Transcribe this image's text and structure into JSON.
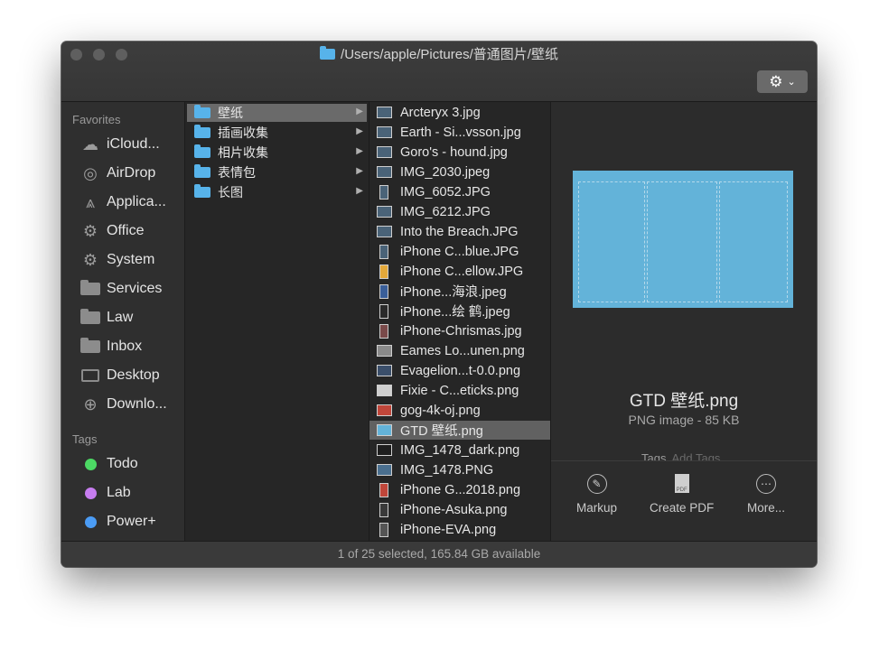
{
  "window": {
    "title": "/Users/apple/Pictures/普通图片/壁纸",
    "icons": {
      "title_folder": "folder-icon",
      "action_menu": "gear-icon"
    }
  },
  "sidebar": {
    "favorites_label": "Favorites",
    "favorites": [
      {
        "label": "iCloud...",
        "icon": "cloud-icon"
      },
      {
        "label": "AirDrop",
        "icon": "airdrop-icon"
      },
      {
        "label": "Applica...",
        "icon": "applications-icon"
      },
      {
        "label": "Office",
        "icon": "gear-icon"
      },
      {
        "label": "System",
        "icon": "gear-icon"
      },
      {
        "label": "Services",
        "icon": "folder-icon"
      },
      {
        "label": "Law",
        "icon": "folder-icon"
      },
      {
        "label": "Inbox",
        "icon": "folder-icon"
      },
      {
        "label": "Desktop",
        "icon": "desktop-icon"
      },
      {
        "label": "Downlo...",
        "icon": "download-icon"
      }
    ],
    "tags_label": "Tags",
    "tags": [
      {
        "label": "Todo",
        "color": "#4cd964"
      },
      {
        "label": "Lab",
        "color": "#c77df0"
      },
      {
        "label": "Power+",
        "color": "#4b9cf5"
      }
    ]
  },
  "column1": {
    "items": [
      {
        "label": "壁纸",
        "selected": true
      },
      {
        "label": "插画收集",
        "selected": false
      },
      {
        "label": "相片收集",
        "selected": false
      },
      {
        "label": "表情包",
        "selected": false
      },
      {
        "label": "长图",
        "selected": false
      }
    ]
  },
  "column2": {
    "items": [
      {
        "label": "Arcteryx 3.jpg"
      },
      {
        "label": "Earth - Si...vsson.jpg"
      },
      {
        "label": "Goro's - hound.jpg"
      },
      {
        "label": "IMG_2030.jpeg"
      },
      {
        "label": "IMG_6052.JPG"
      },
      {
        "label": "IMG_6212.JPG"
      },
      {
        "label": "Into the Breach.JPG"
      },
      {
        "label": "iPhone C...blue.JPG"
      },
      {
        "label": "iPhone C...ellow.JPG"
      },
      {
        "label": "iPhone...海浪.jpeg"
      },
      {
        "label": "iPhone...绘 鹤.jpeg"
      },
      {
        "label": "iPhone-Chrismas.jpg"
      },
      {
        "label": "Eames Lo...unen.png"
      },
      {
        "label": "Evagelion...t-0.0.png"
      },
      {
        "label": "Fixie -  C...eticks.png"
      },
      {
        "label": "gog-4k-oj.png"
      },
      {
        "label": "GTD 壁纸.png"
      },
      {
        "label": "IMG_1478_dark.png"
      },
      {
        "label": "IMG_1478.PNG"
      },
      {
        "label": "iPhone G...2018.png"
      },
      {
        "label": "iPhone-Asuka.png"
      },
      {
        "label": "iPhone-EVA.png"
      }
    ],
    "selected_index": 16
  },
  "preview": {
    "file_name": "GTD 壁纸.png",
    "file_kind": "PNG image - 85 KB",
    "tags_label": "Tags",
    "add_tags_placeholder": "Add Tags...",
    "image_color": "#63b3d9",
    "actions": [
      {
        "label": "Markup",
        "icon": "markup-icon"
      },
      {
        "label": "Create PDF",
        "icon": "pdf-icon"
      },
      {
        "label": "More...",
        "icon": "more-icon"
      }
    ],
    "pdf_badge": "PDF"
  },
  "status": {
    "text": "1 of 25 selected, 165.84 GB available"
  }
}
